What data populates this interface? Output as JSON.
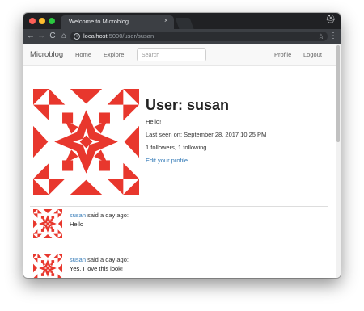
{
  "browser": {
    "tab_title": "Welcome to Microblog",
    "tab_close": "×",
    "url_host": "localhost",
    "url_path": ":5000/user/susan",
    "nav_back": "←",
    "nav_forward": "→",
    "nav_reload": "C",
    "nav_home": "⌂",
    "info": "i",
    "star": "☆",
    "menu": "⋮",
    "incognito": "⛑"
  },
  "navbar": {
    "brand": "Microblog",
    "links": [
      "Home",
      "Explore"
    ],
    "search_placeholder": "Search",
    "right_links": [
      "Profile",
      "Logout"
    ]
  },
  "profile": {
    "heading": "User: susan",
    "about": "Hello!",
    "last_seen": "Last seen on: September 28, 2017 10:25 PM",
    "follow_stats": "1 followers, 1 following.",
    "edit_link": "Edit your profile"
  },
  "posts": [
    {
      "author": "susan",
      "meta": " said a day ago:",
      "body": "Hello"
    },
    {
      "author": "susan",
      "meta": " said a day ago:",
      "body": "Yes, I love this look!"
    }
  ],
  "colors": {
    "avatar": "#e8372d",
    "link": "#337ab7",
    "chrome_dark": "#202124",
    "toolbar": "#3c3f44"
  }
}
